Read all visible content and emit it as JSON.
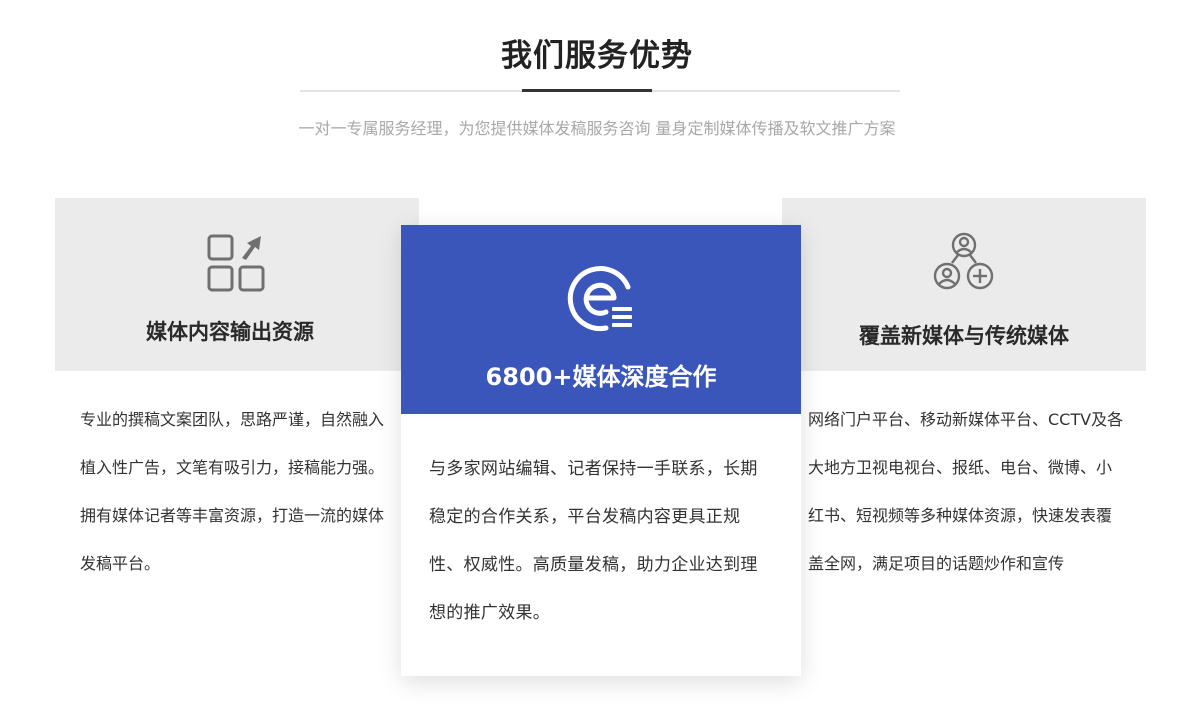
{
  "section": {
    "title": "我们服务优势",
    "subtitle": "一对一专属服务经理，为您提供媒体发稿服务咨询 量身定制媒体传播及软文推广方案"
  },
  "cards": {
    "left": {
      "icon": "apps-grid-icon",
      "title": "媒体内容输出资源",
      "paragraphs": [
        "专业的撰稿文案团队，思路严谨，自然融入植入性广告，文笔有吸引力，接稿能力强。",
        "拥有媒体记者等丰富资源，打造一流的媒体发稿平台。"
      ]
    },
    "center": {
      "icon": "e-logo-icon",
      "title": "6800+媒体深度合作",
      "text": "与多家网站编辑、记者保持一手联系，长期稳定的合作关系，平台发稿内容更具正规性、权威性。高质量发稿，助力企业达到理想的推广效果。",
      "accent_color": "#3b56ba"
    },
    "right": {
      "icon": "user-network-icon",
      "title": "覆盖新媒体与传统媒体",
      "text": "网络门户平台、移动新媒体平台、CCTV及各大地方卫视电视台、报纸、电台、微博、小红书、短视频等多种媒体资源，快速发表覆盖全网，满足项目的话题炒作和宣传"
    }
  },
  "colors": {
    "side_bg": "#ebebeb",
    "text": "#333333",
    "subtitle": "#a8a8a8"
  }
}
